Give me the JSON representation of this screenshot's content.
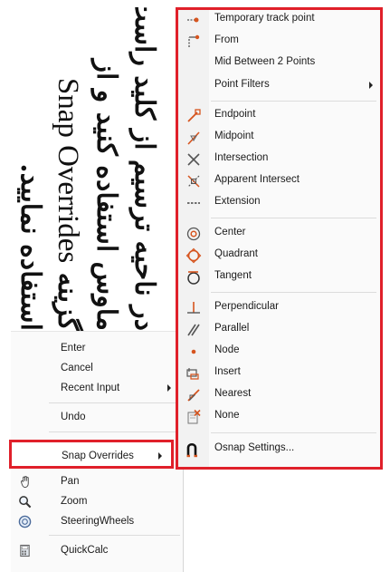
{
  "caption": {
    "line1": "در ناحیه ترسیم از کلید راست",
    "line2_a": "ماوس استفاده کنید و از",
    "line3_b": "گزینه",
    "line3_latin": "Snap Overrides",
    "line4": "استفاده نمایید."
  },
  "context_menu": {
    "items": [
      {
        "label": "Enter"
      },
      {
        "label": "Cancel"
      },
      {
        "label": "Recent Input"
      },
      {
        "label": "Undo"
      },
      {
        "label": "Snap Overrides"
      },
      {
        "label": "Pan",
        "icon": "pan-hand-icon"
      },
      {
        "label": "Zoom",
        "icon": "zoom-magnifier-icon"
      },
      {
        "label": "SteeringWheels",
        "icon": "steering-wheel-icon"
      },
      {
        "label": "QuickCalc",
        "icon": "calculator-icon"
      }
    ]
  },
  "snap_submenu": {
    "items": [
      {
        "label": "Temporary track point",
        "icon": "temporary-track-point-icon"
      },
      {
        "label": "From",
        "icon": "from-icon"
      },
      {
        "label": "Mid Between 2 Points"
      },
      {
        "label": "Point Filters"
      },
      {
        "label": "Endpoint",
        "icon": "endpoint-icon"
      },
      {
        "label": "Midpoint",
        "icon": "midpoint-icon"
      },
      {
        "label": "Intersection",
        "icon": "intersection-icon"
      },
      {
        "label": "Apparent Intersect",
        "icon": "apparent-intersect-icon"
      },
      {
        "label": "Extension",
        "icon": "extension-icon"
      },
      {
        "label": "Center",
        "icon": "center-icon"
      },
      {
        "label": "Quadrant",
        "icon": "quadrant-icon"
      },
      {
        "label": "Tangent",
        "icon": "tangent-icon"
      },
      {
        "label": "Perpendicular",
        "icon": "perpendicular-icon"
      },
      {
        "label": "Parallel",
        "icon": "parallel-icon"
      },
      {
        "label": "Node",
        "icon": "node-icon"
      },
      {
        "label": "Insert",
        "icon": "insert-icon"
      },
      {
        "label": "Nearest",
        "icon": "nearest-icon"
      },
      {
        "label": "None",
        "icon": "none-icon"
      },
      {
        "label": "Osnap Settings...",
        "icon": "osnap-settings-icon"
      }
    ]
  },
  "colors": {
    "highlight_border": "#e0202a",
    "snap_icon": "#d6541e",
    "menu_bg": "#fafafa"
  }
}
